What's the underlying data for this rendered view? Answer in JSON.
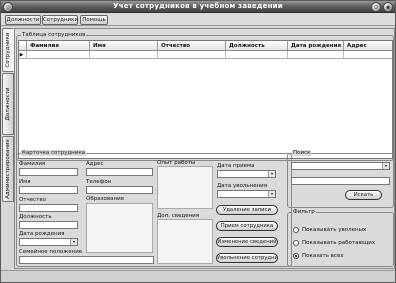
{
  "window": {
    "title": "Учет сотрудников в учебном заведении"
  },
  "menu": {
    "items": [
      "Должности",
      "Сотрудники",
      "Помощь"
    ]
  },
  "side_tabs": [
    "Сотрудники",
    "Должности",
    "Администрирование"
  ],
  "table_group": {
    "label": "Таблица сотрудников"
  },
  "table": {
    "columns": [
      "Фамилия",
      "Имя",
      "Отчество",
      "Должность",
      "Дата рождения",
      "Адрес"
    ],
    "row_indicator": "▶"
  },
  "card": {
    "label": "Карточка сотрудника",
    "fields": {
      "last_name": "Фамилия",
      "first_name": "Имя",
      "patronymic": "Отчество",
      "position": "Должность",
      "birth_date": "Дата рождения",
      "family_status": "Семейное положение",
      "address": "Адрес",
      "phone": "Телефон",
      "education": "Образование",
      "experience": "Опыт работы",
      "extra_info": "Доп. сведения",
      "hire_date": "Дата приема",
      "fire_date": "Дата увольнения"
    },
    "buttons": [
      "Удаление записи",
      "Прием сотрудника",
      "Изменение сведений",
      "Увольнение сотрудника"
    ]
  },
  "search": {
    "label": "Поиск",
    "button": "Искать"
  },
  "filter": {
    "label": "Фильтр",
    "options": [
      "Показывать уволеных",
      "Показывать работающих",
      "Показать всех"
    ],
    "selected_index": 2
  },
  "window_buttons": {
    "left": "◎",
    "right_1": "⊙",
    "right_2": "◉"
  }
}
